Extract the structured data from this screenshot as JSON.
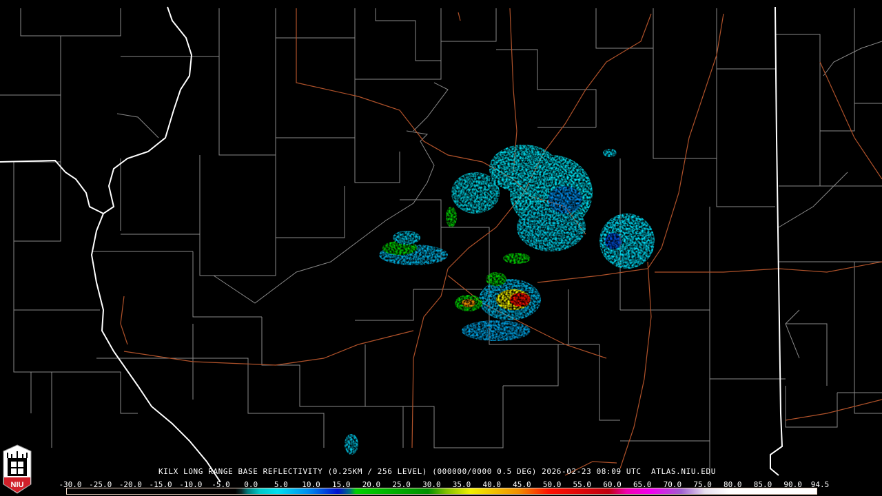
{
  "product_title": "KILX LONG RANGE BASE REFLECTIVITY (0.25KM / 256 LEVEL) (000000/0000 0.5 DEG) 2026-02-23 08:09 UTC  ATLAS.NIU.EDU",
  "logo_text": "NIU",
  "color_scale": {
    "labels": [
      "-30.0",
      "-25.0",
      "-20.0",
      "-15.0",
      "-10.0",
      "-5.0",
      "0.0",
      "5.0",
      "10.0",
      "15.0",
      "20.0",
      "25.0",
      "30.0",
      "35.0",
      "40.0",
      "45.0",
      "50.0",
      "55.0",
      "60.0",
      "65.0",
      "70.0",
      "75.0",
      "80.0",
      "85.0",
      "90.0",
      "94.5"
    ],
    "range_dbz": [
      -30,
      94.5
    ],
    "stops": [
      {
        "dbz": -30,
        "color": "#000000"
      },
      {
        "dbz": -2,
        "color": "#000000"
      },
      {
        "dbz": -1,
        "color": "#0a2a2a"
      },
      {
        "dbz": 0,
        "color": "#007a7a"
      },
      {
        "dbz": 2,
        "color": "#00c8c8"
      },
      {
        "dbz": 5,
        "color": "#00e0f0"
      },
      {
        "dbz": 10,
        "color": "#0090f0"
      },
      {
        "dbz": 15,
        "color": "#0010d0"
      },
      {
        "dbz": 17,
        "color": "#007080"
      },
      {
        "dbz": 18,
        "color": "#00d000"
      },
      {
        "dbz": 30,
        "color": "#009000"
      },
      {
        "dbz": 33,
        "color": "#80c000"
      },
      {
        "dbz": 37,
        "color": "#f0f000"
      },
      {
        "dbz": 45,
        "color": "#f09000"
      },
      {
        "dbz": 50,
        "color": "#ff1000"
      },
      {
        "dbz": 60,
        "color": "#c00010"
      },
      {
        "dbz": 63,
        "color": "#f000b0"
      },
      {
        "dbz": 67,
        "color": "#f000f0"
      },
      {
        "dbz": 72,
        "color": "#a060d0"
      },
      {
        "dbz": 76,
        "color": "#e8e0f0"
      },
      {
        "dbz": 80,
        "color": "#ffffff"
      },
      {
        "dbz": 94.5,
        "color": "#ffffff"
      }
    ]
  },
  "colors": {
    "state_line": "#ffffff",
    "county_line": "#8a8a8a",
    "highway": "#b0522a",
    "logo_red": "#d0202a"
  }
}
